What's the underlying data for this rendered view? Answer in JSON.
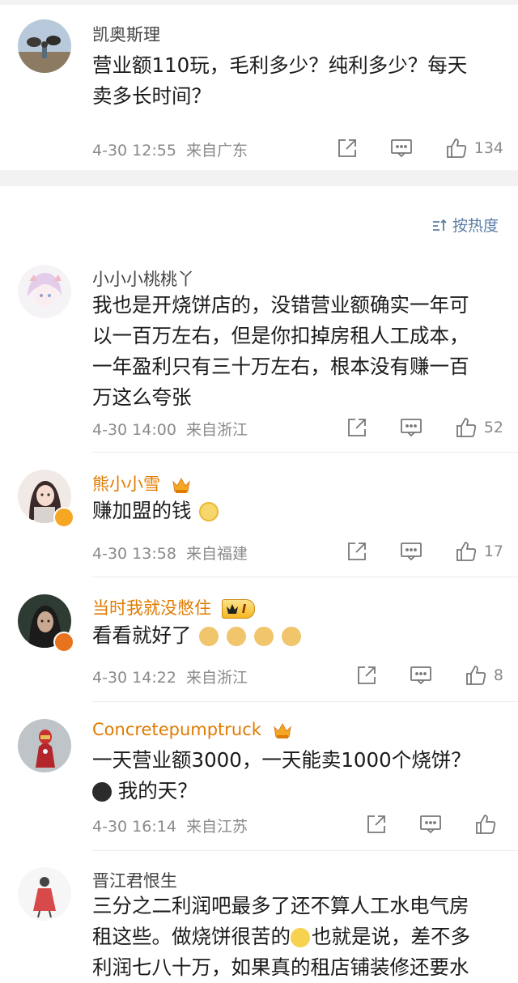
{
  "comments": [
    {
      "username": "凯奥斯理",
      "line1": "营业额110玩，毛利多少？纯利多少？每天",
      "line2": "卖多长时间？",
      "time": "4-30 12:55",
      "location": "来自广东",
      "likes": "134",
      "avatar_icon": "cattle-photo-avatar"
    },
    {
      "username": "小小小桃桃丫",
      "line1": "我也是开烧饼店的，没错营业额确实一年可",
      "line2": "以一百万左右，但是你扣掉房租人工成本，",
      "line3": "一年盈利只有三十万左右，根本没有赚一百",
      "line4": "万这么夸张",
      "time": "4-30 14:00",
      "location": "来自浙江",
      "likes": "52",
      "avatar_icon": "anime-girl-avatar"
    },
    {
      "username": "熊小小雪",
      "line1": "赚加盟的钱",
      "time": "4-30 13:58",
      "location": "来自福建",
      "likes": "17",
      "avatar_icon": "illustrated-woman-avatar",
      "emoji_icon": "grimace-emoji"
    },
    {
      "username": "当时我就没憋住",
      "line1": "看看就好了",
      "time": "4-30 14:22",
      "location": "来自浙江",
      "likes": "8",
      "avatar_icon": "woman-portrait-avatar",
      "level_badge": "I",
      "emoji_icon": "doge-emoji"
    },
    {
      "username": "Concretepumptruck",
      "line1": "一天营业额3000，一天能卖1000个烧饼？",
      "line2": "我的天？",
      "time": "4-30 16:14",
      "location": "来自江苏",
      "likes": "",
      "avatar_icon": "iron-man-avatar",
      "emoji_icon": "shocked-emoji"
    },
    {
      "username": "晋江君恨生",
      "line1": "三分之二利润吧最多了还不算人工水电气房",
      "line2a": "租这些。做烧饼很苦的",
      "line2b": "也就是说，差不多",
      "line3": "利润七八十万，如果真的租店铺装修还要水",
      "avatar_icon": "sketch-figure-avatar",
      "emoji_icon": "laugh-cry-emoji"
    }
  ],
  "sort": {
    "label": "按热度"
  },
  "colors": {
    "accent_link": "#5a7da6",
    "vip_name": "#e07b00",
    "meta": "#8a8a8a",
    "verified": "#f5a623"
  }
}
